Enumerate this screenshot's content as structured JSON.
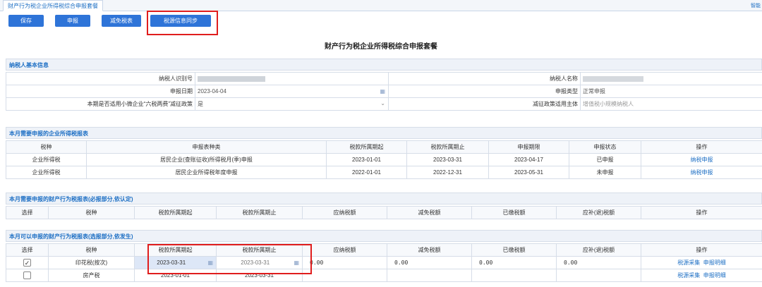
{
  "app": {
    "tab_title": "财产行为税企业所得税综合申报套餐",
    "help_text": "智能"
  },
  "toolbar": {
    "save": "保存",
    "declare": "申报",
    "relief": "减免税表",
    "sync": "税源信息同步"
  },
  "page_title": "财产行为税企业所得税综合申报套餐",
  "basic_info": {
    "section_title": "纳税人基本信息",
    "taxpayer_id_label": "纳税人识别号",
    "taxpayer_name_label": "纳税人名称",
    "declare_date_label": "申报日期",
    "declare_date_value": "2023-04-04",
    "declare_type_label": "申报类型",
    "declare_type_value": "正常申报",
    "small_policy_label": "本期是否适用小微企业“六税两费”减征政策",
    "small_policy_value": "是",
    "relief_subject_label": "减征政策适用主体",
    "relief_subject_value": "增值税小规模纳税人"
  },
  "cit": {
    "section_title": "本月需要申报的企业所得税报表",
    "headers": [
      "税种",
      "申报表种类",
      "税款所属期起",
      "税款所属期止",
      "申报期限",
      "申报状态",
      "操作"
    ],
    "rows": [
      {
        "tax": "企业所得税",
        "form": "居民企业(查账征收)所得税月(季)申报",
        "start": "2023-01-01",
        "end": "2023-03-31",
        "deadline": "2023-04-17",
        "status": "已申报",
        "action": "纳税申报"
      },
      {
        "tax": "企业所得税",
        "form": "居民企业所得税年度申报",
        "start": "2022-01-01",
        "end": "2022-12-31",
        "deadline": "2023-05-31",
        "status": "未申报",
        "action": "纳税申报"
      }
    ]
  },
  "required": {
    "section_title": "本月需要申报的财产行为税报表(必报部分,依认定)",
    "headers": [
      "选择",
      "税种",
      "税款所属期起",
      "税款所属期止",
      "应纳税额",
      "减免税额",
      "已缴税额",
      "应补(退)税额",
      "操作"
    ]
  },
  "optional": {
    "section_title": "本月可以申报的财产行为税报表(选报部分,依发生)",
    "headers": [
      "选择",
      "税种",
      "税款所属期起",
      "税款所属期止",
      "应纳税额",
      "减免税额",
      "已缴税额",
      "应补(退)税额",
      "操作"
    ],
    "rows": [
      {
        "check": "✓",
        "tax": "印花税(按次)",
        "start": "2023-03-31",
        "end": "2023-03-31",
        "payable": "0.00",
        "relief": "0.00",
        "paid": "0.00",
        "due": "0.00",
        "action1": "税源采集",
        "action2": "申报明细"
      },
      {
        "check": "",
        "tax": "房产税",
        "start": "2023-01-01",
        "end": "2023-03-31",
        "payable": "",
        "relief": "",
        "paid": "",
        "due": "",
        "action1": "税源采集",
        "action2": "申报明细"
      }
    ]
  },
  "colors": {
    "accent": "#2e74d8",
    "highlight": "#e01d1d",
    "link": "#1d6fc4"
  }
}
